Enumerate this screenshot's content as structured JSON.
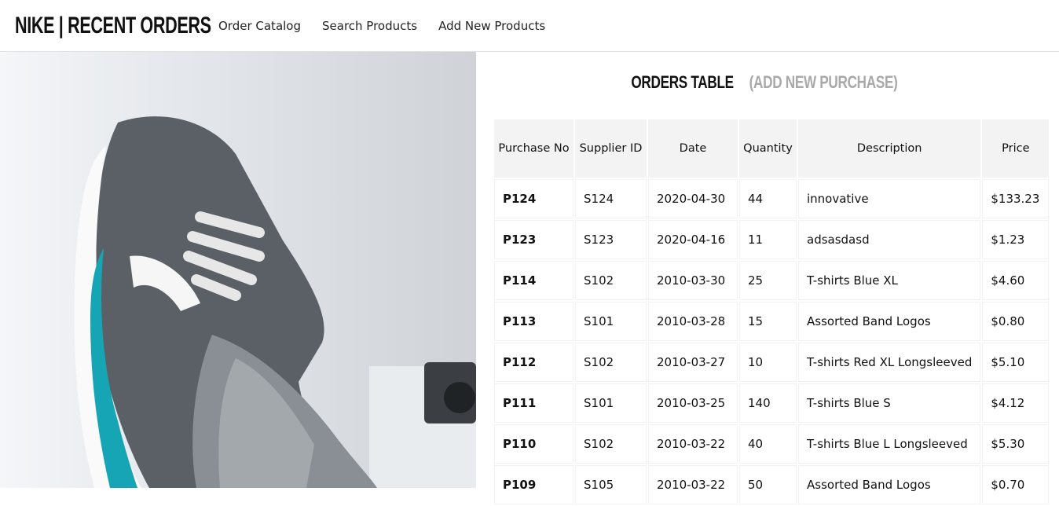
{
  "header": {
    "brand": "NIKE | RECENT ORDERS",
    "nav": [
      "Order Catalog",
      "Search Products",
      "Add New Products"
    ]
  },
  "hero": {
    "alt": "sneaker-photo"
  },
  "orders": {
    "title": "ORDERS TABLE",
    "add_link": "(ADD NEW PURCHASE)",
    "columns": [
      "Purchase No",
      "Supplier ID",
      "Date",
      "Quantity",
      "Description",
      "Price"
    ],
    "rows": [
      [
        "P124",
        "S124",
        "2020-04-30",
        "44",
        "innovative",
        "$133.23"
      ],
      [
        "P123",
        "S123",
        "2020-04-16",
        "11",
        "adsasdasd",
        "$1.23"
      ],
      [
        "P114",
        "S102",
        "2010-03-30",
        "25",
        "T-shirts Blue XL",
        "$4.60"
      ],
      [
        "P113",
        "S101",
        "2010-03-28",
        "15",
        "Assorted Band Logos",
        "$0.80"
      ],
      [
        "P112",
        "S102",
        "2010-03-27",
        "10",
        "T-shirts Red XL Longsleeved",
        "$5.10"
      ],
      [
        "P111",
        "S101",
        "2010-03-25",
        "140",
        "T-shirts Blue S",
        "$4.12"
      ],
      [
        "P110",
        "S102",
        "2010-03-22",
        "40",
        "T-shirts Blue L Longsleeved",
        "$5.30"
      ],
      [
        "P109",
        "S105",
        "2010-03-22",
        "50",
        "Assorted Band Logos",
        "$0.70"
      ]
    ]
  }
}
